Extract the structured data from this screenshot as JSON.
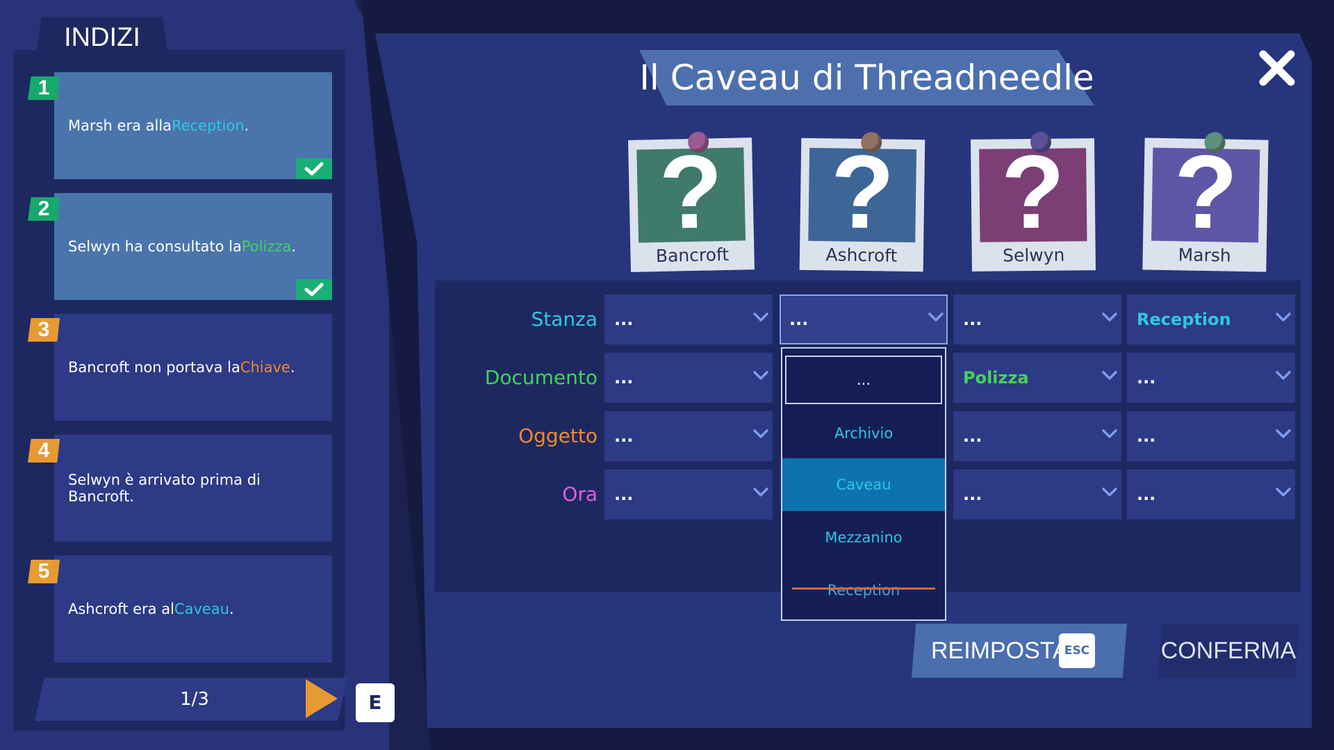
{
  "clues": {
    "title": "INDIZI",
    "items": [
      {
        "num": "1",
        "pre": "Marsh era alla ",
        "hl": "Reception",
        "post": ".",
        "done": true
      },
      {
        "num": "2",
        "pre": "Selwyn ha consultato la ",
        "hl": "Polizza",
        "post": ".",
        "done": true
      },
      {
        "num": "3",
        "pre": "Bancroft non portava la ",
        "hl": "Chiave",
        "post": ".",
        "done": false
      },
      {
        "num": "4",
        "pre": "Selwyn è arrivato prima di Bancroft.",
        "hl": "",
        "post": "",
        "done": false
      },
      {
        "num": "5",
        "pre": "Ashcroft era al ",
        "hl": "Caveau",
        "post": ".",
        "done": false
      }
    ],
    "page": "1/3",
    "key": "E"
  },
  "title": "Il Caveau di Threadneedle",
  "suspects": [
    {
      "name": "Bancroft",
      "color": "#3f7a6b",
      "pin": "#9a5b90"
    },
    {
      "name": "Ashcroft",
      "color": "#3d6697",
      "pin": "#8f7262"
    },
    {
      "name": "Selwyn",
      "color": "#7b3e75",
      "pin": "#5d4f98"
    },
    {
      "name": "Marsh",
      "color": "#5f55a6",
      "pin": "#5e8f7b"
    }
  ],
  "rows": [
    {
      "label": "Stanza",
      "cells": [
        "...",
        "...",
        "...",
        "Reception"
      ]
    },
    {
      "label": "Documento",
      "cells": [
        "...",
        "",
        "Polizza",
        "..."
      ]
    },
    {
      "label": "Oggetto",
      "cells": [
        "...",
        "",
        "...",
        "..."
      ]
    },
    {
      "label": "Ora",
      "cells": [
        "...",
        "",
        "...",
        "..."
      ]
    }
  ],
  "dropdown": {
    "options": [
      "...",
      "Archivio",
      "Caveau",
      "Mezzanino",
      "Reception"
    ],
    "selected": "Caveau",
    "crossed_out": "Reception"
  },
  "buttons": {
    "reset": "REIMPOSTA",
    "reset_key": "ESC",
    "confirm": "CONFERMA"
  }
}
